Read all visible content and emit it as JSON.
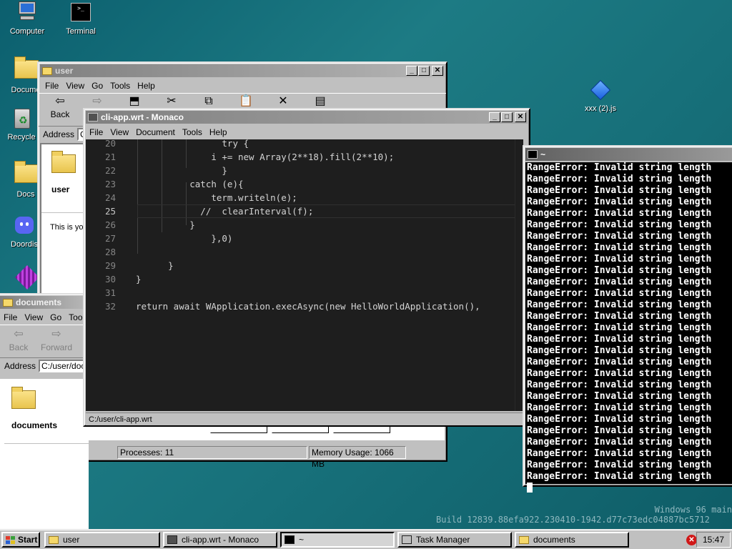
{
  "desktop": {
    "icons": [
      {
        "label": "Computer",
        "icon": "computer-icon"
      },
      {
        "label": "Terminal",
        "icon": "terminal-icon"
      },
      {
        "label": "Docume",
        "icon": "folder-icon"
      },
      {
        "label": "Recycle",
        "icon": "recycle-bin-icon"
      },
      {
        "label": "Docs",
        "icon": "folder-icon"
      },
      {
        "label": "Doordis",
        "icon": "discord-icon"
      },
      {
        "label": "xxx (2).js",
        "icon": "js-file-icon"
      }
    ],
    "watermark_line1": "Windows 96 main",
    "watermark_line2": "Build 12839.88efa922.230410-1942.d77c73edc04887bc5712"
  },
  "user_window": {
    "title": "user",
    "menu": [
      "File",
      "View",
      "Go",
      "Tools",
      "Help"
    ],
    "toolbar": {
      "back": "Back"
    },
    "address_label": "Address",
    "address_value": "C:",
    "folder_name": "user",
    "info_text": "This is you",
    "status_processes": "Processes: 11",
    "status_memory": "Memory Usage: 1066 MB"
  },
  "documents_window": {
    "title": "documents",
    "menu": [
      "File",
      "View",
      "Go",
      "Tools"
    ],
    "back": "Back",
    "forward": "Forward",
    "address_label": "Address",
    "address_value": "C:/user/docu",
    "folder_name": "documents"
  },
  "editor_window": {
    "title": "cli-app.wrt - Monaco",
    "menu": [
      "File",
      "View",
      "Document",
      "Tools",
      "Help"
    ],
    "status_path": "C:/user/cli-app.wrt",
    "lines": [
      {
        "num": "20",
        "code": "                try {"
      },
      {
        "num": "21",
        "code": "              i += new Array(2**18).fill(2**10);"
      },
      {
        "num": "22",
        "code": "                }"
      },
      {
        "num": "23",
        "code": "          catch (e){"
      },
      {
        "num": "24",
        "code": "              term.writeln(e);"
      },
      {
        "num": "25",
        "code": "            //  clearInterval(f);"
      },
      {
        "num": "26",
        "code": "          }"
      },
      {
        "num": "27",
        "code": "              },0)"
      },
      {
        "num": "28",
        "code": ""
      },
      {
        "num": "29",
        "code": "      }"
      },
      {
        "num": "30",
        "code": "}"
      },
      {
        "num": "31",
        "code": ""
      },
      {
        "num": "32",
        "code": "return await WApplication.execAsync(new HelloWorldApplication(),"
      }
    ]
  },
  "terminal_window": {
    "title": "~",
    "line_text": "RangeError: Invalid string length",
    "line_count": 28
  },
  "taskbar": {
    "start": "Start",
    "items": [
      "user",
      "cli-app.wrt - Monaco",
      "~",
      "Task Manager",
      "documents"
    ],
    "clock": "15:47"
  }
}
